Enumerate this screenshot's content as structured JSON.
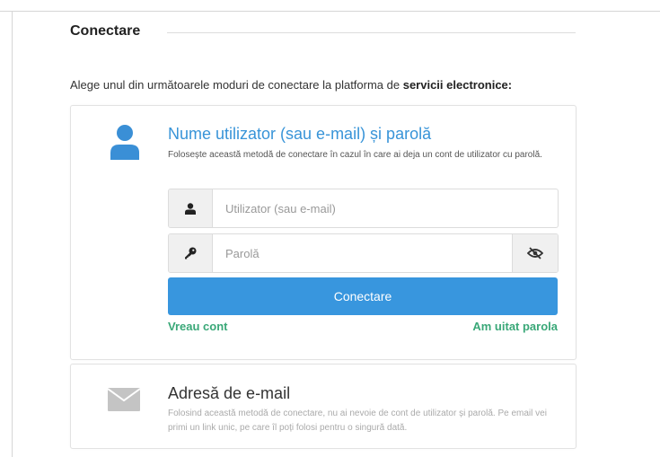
{
  "section": {
    "title": "Conectare",
    "intro_prefix": "Alege unul din următoarele moduri de conectare la platforma de ",
    "intro_bold": "servicii electronice:"
  },
  "login_card": {
    "heading": "Nume utilizator (sau e-mail) și parolă",
    "description": "Folosește această metodă de conectare în cazul în care ai deja un cont de utilizator cu parolă.",
    "username": {
      "placeholder": "Utilizator (sau e-mail)",
      "value": ""
    },
    "password": {
      "placeholder": "Parolă",
      "value": ""
    },
    "connect_button": "Conectare",
    "register_link": "Vreau cont",
    "forgot_link": "Am uitat parola"
  },
  "email_card": {
    "heading": "Adresă de e-mail",
    "description": "Folosind această metodă de conectare, nu ai nevoie de cont de utilizator și parolă. Pe email vei primi un link unic, pe care îl poți folosi pentru o singură dată."
  },
  "icons": {
    "user": "user-icon",
    "user_small": "user-small-icon",
    "key": "key-icon",
    "eye_slash": "eye-slash-icon",
    "mail": "envelope-icon"
  },
  "colors": {
    "accent": "#3896de",
    "heading_blue": "#3894d8",
    "link_green": "#3aa878",
    "icon_gray": "#c4c4c4"
  }
}
